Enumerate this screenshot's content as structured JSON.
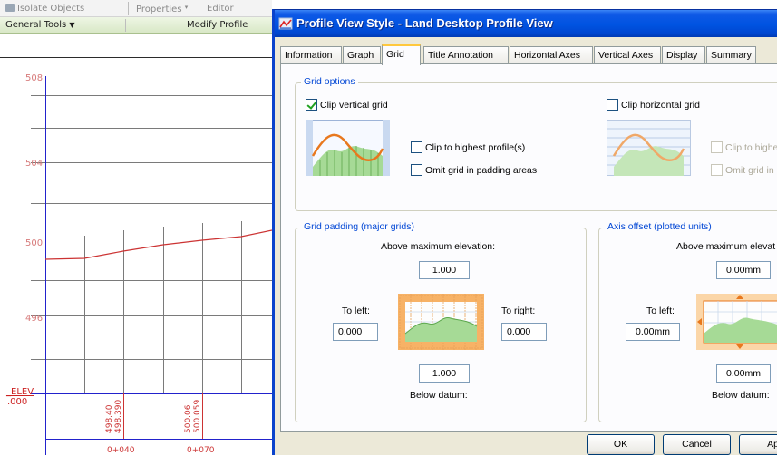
{
  "app": {
    "ribbon": {
      "isolate_objects": "Isolate Objects",
      "properties": "Properties",
      "editor": "Editor"
    },
    "panel_bar": {
      "general_tools": "General Tools",
      "modify_profile": "Modify Profile"
    },
    "profile": {
      "elevations": [
        "508",
        "504",
        "500",
        "496"
      ],
      "axis_label": "_ELEV",
      "datum_label": ".000",
      "station_elevations": [
        "498.40",
        "498.390",
        "500.06",
        "500.059"
      ],
      "stations": [
        "0+040",
        "0+070"
      ]
    }
  },
  "dialog": {
    "title": "Profile View Style - Land Desktop Profile View",
    "tabs": [
      {
        "label": "Information",
        "active": false
      },
      {
        "label": "Graph",
        "active": false
      },
      {
        "label": "Grid",
        "active": true
      },
      {
        "label": "Title Annotation",
        "active": false
      },
      {
        "label": "Horizontal Axes",
        "active": false
      },
      {
        "label": "Vertical Axes",
        "active": false
      },
      {
        "label": "Display",
        "active": false
      },
      {
        "label": "Summary",
        "active": false
      }
    ],
    "grid_options": {
      "title": "Grid options",
      "clip_vertical": {
        "label": "Clip vertical grid",
        "checked": true
      },
      "clip_highest_profiles": {
        "label": "Clip to highest profile(s)",
        "checked": false
      },
      "omit_grid_padding": {
        "label": "Omit grid in padding areas",
        "checked": false
      },
      "clip_horizontal": {
        "label": "Clip horizontal grid",
        "checked": false
      },
      "clip_highest_disabled": {
        "label": "Clip to highe",
        "checked": false
      },
      "omit_grid_disabled": {
        "label": "Omit grid in",
        "checked": false
      }
    },
    "grid_padding": {
      "title": "Grid padding (major grids)",
      "above_label": "Above maximum elevation:",
      "above_value": "1.000",
      "left_label": "To left:",
      "left_value": "0.000",
      "right_label": "To right:",
      "right_value": "0.000",
      "below_value": "1.000",
      "below_label": "Below datum:"
    },
    "axis_offset": {
      "title": "Axis offset (plotted units)",
      "above_label": "Above maximum elevat",
      "above_value": "0.00mm",
      "left_label": "To left:",
      "left_value": "0.00mm",
      "below_value": "0.00mm",
      "below_label": "Below datum:"
    },
    "buttons": {
      "ok": "OK",
      "cancel": "Cancel",
      "apply": "Ap"
    },
    "colors": {
      "title_blue": "#0054e3",
      "group_title": "#0046d5",
      "active_tab_accent": "#ffc83c",
      "profile_red": "#cc2222",
      "preview_green": "#7fc86a",
      "preview_orange": "#e8781e"
    }
  }
}
